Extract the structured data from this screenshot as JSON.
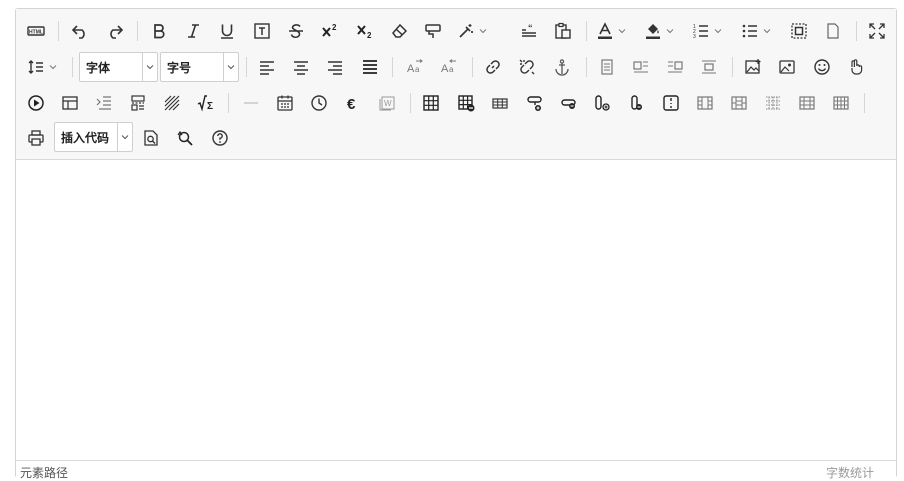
{
  "editor": {
    "font_family_select": "字体",
    "font_size_select": "字号",
    "code_select": "插入代码",
    "status_left": "元素路径",
    "status_right": "字数统计"
  },
  "toolbar_icons": {
    "row1": [
      "source-code-icon",
      "undo-icon",
      "redo-icon",
      "bold-icon",
      "italic-icon",
      "underline-icon",
      "font-border-icon",
      "strikethrough-icon",
      "superscript-icon",
      "subscript-icon",
      "eraser-icon",
      "format-painter-icon",
      "auto-format-icon",
      "blockquote-icon",
      "paste-plain-icon",
      "font-color-icon",
      "background-color-icon",
      "ordered-list-icon",
      "unordered-list-icon",
      "select-all-icon",
      "clear-doc-icon",
      "fullscreen-icon"
    ],
    "row2": [
      "line-height-icon",
      "align-left-icon",
      "align-center-icon",
      "align-right-icon",
      "justify-icon",
      "text-direction-ltr-icon",
      "text-direction-rtl-icon",
      "link-icon",
      "unlink-icon",
      "anchor-icon",
      "image-none-icon",
      "image-left-icon",
      "image-right-icon",
      "image-center-icon",
      "insert-image-icon",
      "background-image-icon",
      "emoji-icon",
      "scrawl-icon"
    ],
    "row3": [
      "insert-video-icon",
      "template-icon",
      "indent-icon",
      "page-break-icon",
      "background-icon",
      "formula-icon",
      "horizontal-rule-icon",
      "date-icon",
      "time-icon",
      "special-char-icon",
      "wordimage-icon",
      "insert-table-icon",
      "delete-table-icon",
      "insert-row-icon",
      "insert-row-after-icon",
      "delete-row-icon",
      "insert-col-icon",
      "delete-col-icon",
      "merge-cells-icon",
      "merge-right-icon",
      "merge-down-icon",
      "split-cells-icon",
      "split-rows-icon",
      "split-cols-icon"
    ],
    "row4": [
      "print-icon",
      "preview-icon",
      "search-replace-icon",
      "help-icon"
    ]
  }
}
